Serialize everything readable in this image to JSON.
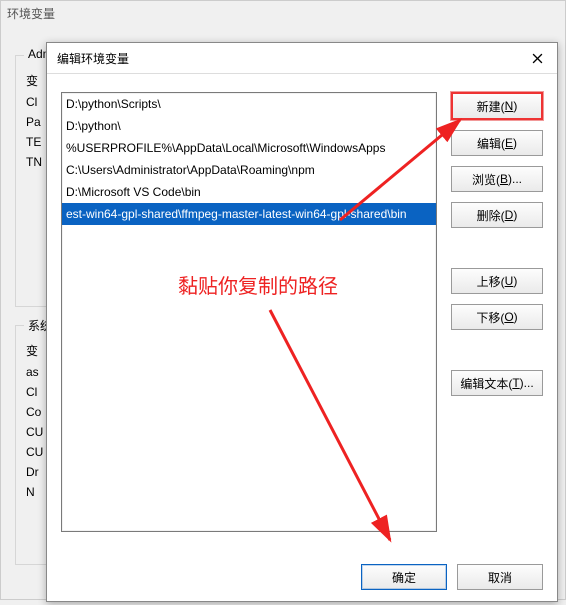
{
  "back_window": {
    "title": "环境变量",
    "upper_legend": "Adm",
    "upper_items": [
      "变",
      "Cl",
      "Pa",
      "TE",
      "TN"
    ],
    "lower_legend": "系统",
    "lower_items": [
      "变",
      "as",
      "Cl",
      "Co",
      "CU",
      "CU",
      "Dr",
      "N"
    ]
  },
  "dialog": {
    "title": "编辑环境变量",
    "close_icon": "close-icon",
    "list": [
      {
        "text": "D:\\python\\Scripts\\",
        "selected": false
      },
      {
        "text": "D:\\python\\",
        "selected": false
      },
      {
        "text": "%USERPROFILE%\\AppData\\Local\\Microsoft\\WindowsApps",
        "selected": false
      },
      {
        "text": "C:\\Users\\Administrator\\AppData\\Roaming\\npm",
        "selected": false
      },
      {
        "text": "D:\\Microsoft VS Code\\bin",
        "selected": false
      },
      {
        "text": "est-win64-gpl-shared\\ffmpeg-master-latest-win64-gpl-shared\\bin",
        "selected": true
      }
    ],
    "buttons": {
      "new": {
        "label": "新建(",
        "hotkey": "N",
        "suffix": ")"
      },
      "edit": {
        "label": "编辑(",
        "hotkey": "E",
        "suffix": ")"
      },
      "browse": {
        "label": "浏览(",
        "hotkey": "B",
        "suffix": ")..."
      },
      "delete": {
        "label": "删除(",
        "hotkey": "D",
        "suffix": ")"
      },
      "up": {
        "label": "上移(",
        "hotkey": "U",
        "suffix": ")"
      },
      "down": {
        "label": "下移(",
        "hotkey": "O",
        "suffix": ")"
      },
      "edit_text": {
        "label": "编辑文本(",
        "hotkey": "T",
        "suffix": ")..."
      }
    },
    "footer": {
      "ok": "确定",
      "cancel": "取消"
    }
  },
  "annotation": {
    "paste_hint": "黏贴你复制的路径"
  }
}
